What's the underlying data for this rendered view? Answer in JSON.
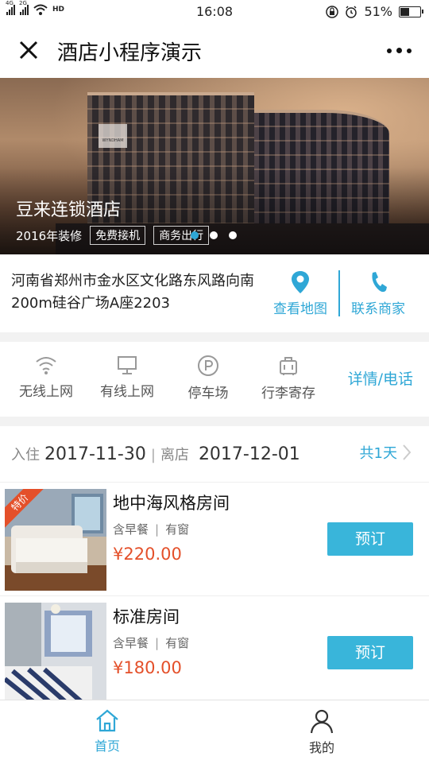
{
  "status_bar": {
    "net_left": "4G",
    "net_right": "2G",
    "hd": "HD",
    "time": "16:08",
    "battery": "51%",
    "battery_level": 0.51
  },
  "nav": {
    "title": "酒店小程序演示"
  },
  "banner": {
    "hotel_name": "豆来连锁酒店",
    "renovation": "2016年装修",
    "tags": [
      "免费接机",
      "商务出行"
    ],
    "slide_count": 3,
    "active_slide": 0,
    "building_sign": "WYNDHAM"
  },
  "address": {
    "text": "河南省郑州市金水区文化路东风路向南200m硅谷广场A座2203",
    "map_label": "查看地图",
    "contact_label": "联系商家"
  },
  "facilities": {
    "items": [
      {
        "label": "无线上网",
        "icon": "wifi-icon"
      },
      {
        "label": "有线上网",
        "icon": "monitor-icon"
      },
      {
        "label": "停车场",
        "icon": "parking-icon"
      },
      {
        "label": "行李寄存",
        "icon": "luggage-icon"
      }
    ],
    "detail_label": "详情/电话"
  },
  "dates": {
    "checkin_label": "入住",
    "checkin": "2017-11-30",
    "separator": "|",
    "checkout_label": "离店",
    "checkout": "2017-12-01",
    "total": "共1天"
  },
  "rooms": [
    {
      "name": "地中海风格房间",
      "feature1": "含早餐",
      "feature2": "有窗",
      "price": "¥220.00",
      "book": "预订",
      "badge": "特价"
    },
    {
      "name": "标准房间",
      "feature1": "含早餐",
      "feature2": "有窗",
      "price": "¥180.00",
      "book": "预订",
      "badge": ""
    }
  ],
  "tabs": [
    {
      "label": "首页",
      "icon": "home-icon",
      "active": true
    },
    {
      "label": "我的",
      "icon": "user-icon",
      "active": false
    }
  ],
  "colors": {
    "accent": "#2fa7d6",
    "button": "#39b5da",
    "price": "#e4502a"
  }
}
